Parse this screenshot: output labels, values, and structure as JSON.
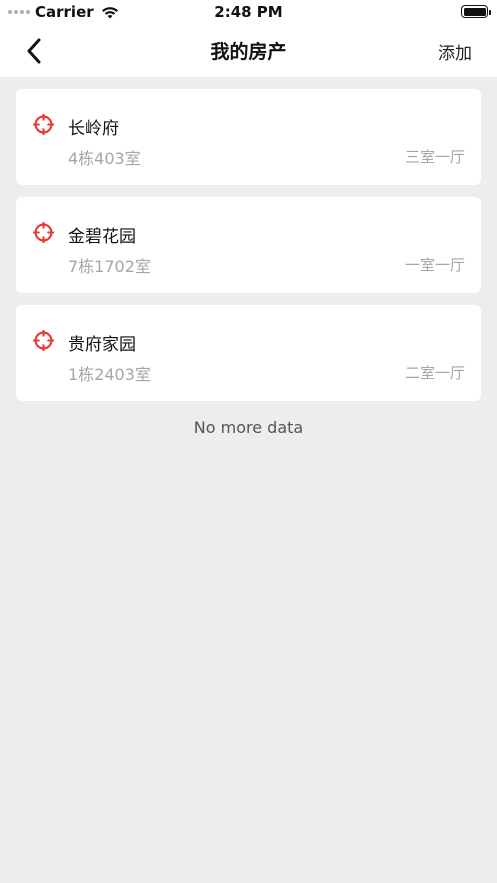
{
  "status_bar": {
    "carrier": "Carrier",
    "time": "2:48 PM"
  },
  "nav": {
    "title": "我的房产",
    "action_label": "添加",
    "back_icon": "chevron-left-icon"
  },
  "properties": [
    {
      "name": "长岭府",
      "unit": "4栋403室",
      "layout": "三室一厅",
      "icon": "location-target-icon"
    },
    {
      "name": "金碧花园",
      "unit": "7栋1702室",
      "layout": "一室一厅",
      "icon": "location-target-icon"
    },
    {
      "name": "贵府家园",
      "unit": "1栋2403室",
      "layout": "二室一厅",
      "icon": "location-target-icon"
    }
  ],
  "footer": {
    "no_more_text": "No more data"
  },
  "colors": {
    "accent_icon": "#e53935",
    "background": "#ededed",
    "card": "#ffffff",
    "muted_text": "#a6a6a6"
  }
}
